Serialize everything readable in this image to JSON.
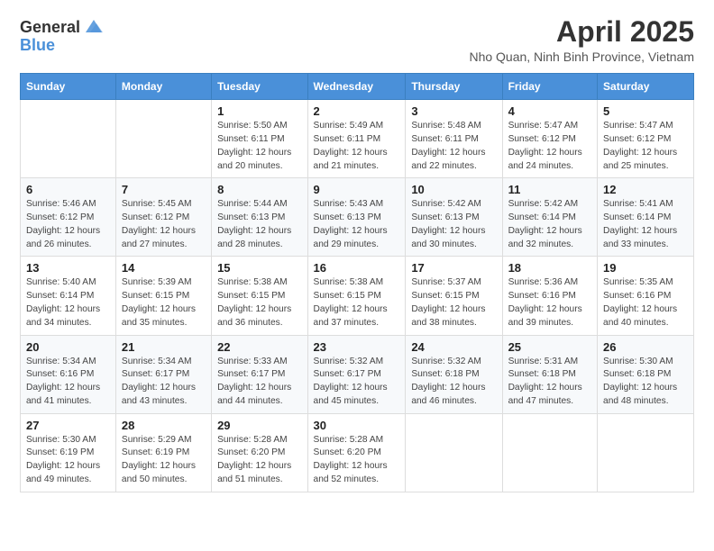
{
  "header": {
    "logo_general": "General",
    "logo_blue": "Blue",
    "month_title": "April 2025",
    "subtitle": "Nho Quan, Ninh Binh Province, Vietnam"
  },
  "weekdays": [
    "Sunday",
    "Monday",
    "Tuesday",
    "Wednesday",
    "Thursday",
    "Friday",
    "Saturday"
  ],
  "weeks": [
    [
      {
        "day": "",
        "info": ""
      },
      {
        "day": "",
        "info": ""
      },
      {
        "day": "1",
        "info": "Sunrise: 5:50 AM\nSunset: 6:11 PM\nDaylight: 12 hours and 20 minutes."
      },
      {
        "day": "2",
        "info": "Sunrise: 5:49 AM\nSunset: 6:11 PM\nDaylight: 12 hours and 21 minutes."
      },
      {
        "day": "3",
        "info": "Sunrise: 5:48 AM\nSunset: 6:11 PM\nDaylight: 12 hours and 22 minutes."
      },
      {
        "day": "4",
        "info": "Sunrise: 5:47 AM\nSunset: 6:12 PM\nDaylight: 12 hours and 24 minutes."
      },
      {
        "day": "5",
        "info": "Sunrise: 5:47 AM\nSunset: 6:12 PM\nDaylight: 12 hours and 25 minutes."
      }
    ],
    [
      {
        "day": "6",
        "info": "Sunrise: 5:46 AM\nSunset: 6:12 PM\nDaylight: 12 hours and 26 minutes."
      },
      {
        "day": "7",
        "info": "Sunrise: 5:45 AM\nSunset: 6:12 PM\nDaylight: 12 hours and 27 minutes."
      },
      {
        "day": "8",
        "info": "Sunrise: 5:44 AM\nSunset: 6:13 PM\nDaylight: 12 hours and 28 minutes."
      },
      {
        "day": "9",
        "info": "Sunrise: 5:43 AM\nSunset: 6:13 PM\nDaylight: 12 hours and 29 minutes."
      },
      {
        "day": "10",
        "info": "Sunrise: 5:42 AM\nSunset: 6:13 PM\nDaylight: 12 hours and 30 minutes."
      },
      {
        "day": "11",
        "info": "Sunrise: 5:42 AM\nSunset: 6:14 PM\nDaylight: 12 hours and 32 minutes."
      },
      {
        "day": "12",
        "info": "Sunrise: 5:41 AM\nSunset: 6:14 PM\nDaylight: 12 hours and 33 minutes."
      }
    ],
    [
      {
        "day": "13",
        "info": "Sunrise: 5:40 AM\nSunset: 6:14 PM\nDaylight: 12 hours and 34 minutes."
      },
      {
        "day": "14",
        "info": "Sunrise: 5:39 AM\nSunset: 6:15 PM\nDaylight: 12 hours and 35 minutes."
      },
      {
        "day": "15",
        "info": "Sunrise: 5:38 AM\nSunset: 6:15 PM\nDaylight: 12 hours and 36 minutes."
      },
      {
        "day": "16",
        "info": "Sunrise: 5:38 AM\nSunset: 6:15 PM\nDaylight: 12 hours and 37 minutes."
      },
      {
        "day": "17",
        "info": "Sunrise: 5:37 AM\nSunset: 6:15 PM\nDaylight: 12 hours and 38 minutes."
      },
      {
        "day": "18",
        "info": "Sunrise: 5:36 AM\nSunset: 6:16 PM\nDaylight: 12 hours and 39 minutes."
      },
      {
        "day": "19",
        "info": "Sunrise: 5:35 AM\nSunset: 6:16 PM\nDaylight: 12 hours and 40 minutes."
      }
    ],
    [
      {
        "day": "20",
        "info": "Sunrise: 5:34 AM\nSunset: 6:16 PM\nDaylight: 12 hours and 41 minutes."
      },
      {
        "day": "21",
        "info": "Sunrise: 5:34 AM\nSunset: 6:17 PM\nDaylight: 12 hours and 43 minutes."
      },
      {
        "day": "22",
        "info": "Sunrise: 5:33 AM\nSunset: 6:17 PM\nDaylight: 12 hours and 44 minutes."
      },
      {
        "day": "23",
        "info": "Sunrise: 5:32 AM\nSunset: 6:17 PM\nDaylight: 12 hours and 45 minutes."
      },
      {
        "day": "24",
        "info": "Sunrise: 5:32 AM\nSunset: 6:18 PM\nDaylight: 12 hours and 46 minutes."
      },
      {
        "day": "25",
        "info": "Sunrise: 5:31 AM\nSunset: 6:18 PM\nDaylight: 12 hours and 47 minutes."
      },
      {
        "day": "26",
        "info": "Sunrise: 5:30 AM\nSunset: 6:18 PM\nDaylight: 12 hours and 48 minutes."
      }
    ],
    [
      {
        "day": "27",
        "info": "Sunrise: 5:30 AM\nSunset: 6:19 PM\nDaylight: 12 hours and 49 minutes."
      },
      {
        "day": "28",
        "info": "Sunrise: 5:29 AM\nSunset: 6:19 PM\nDaylight: 12 hours and 50 minutes."
      },
      {
        "day": "29",
        "info": "Sunrise: 5:28 AM\nSunset: 6:20 PM\nDaylight: 12 hours and 51 minutes."
      },
      {
        "day": "30",
        "info": "Sunrise: 5:28 AM\nSunset: 6:20 PM\nDaylight: 12 hours and 52 minutes."
      },
      {
        "day": "",
        "info": ""
      },
      {
        "day": "",
        "info": ""
      },
      {
        "day": "",
        "info": ""
      }
    ]
  ]
}
